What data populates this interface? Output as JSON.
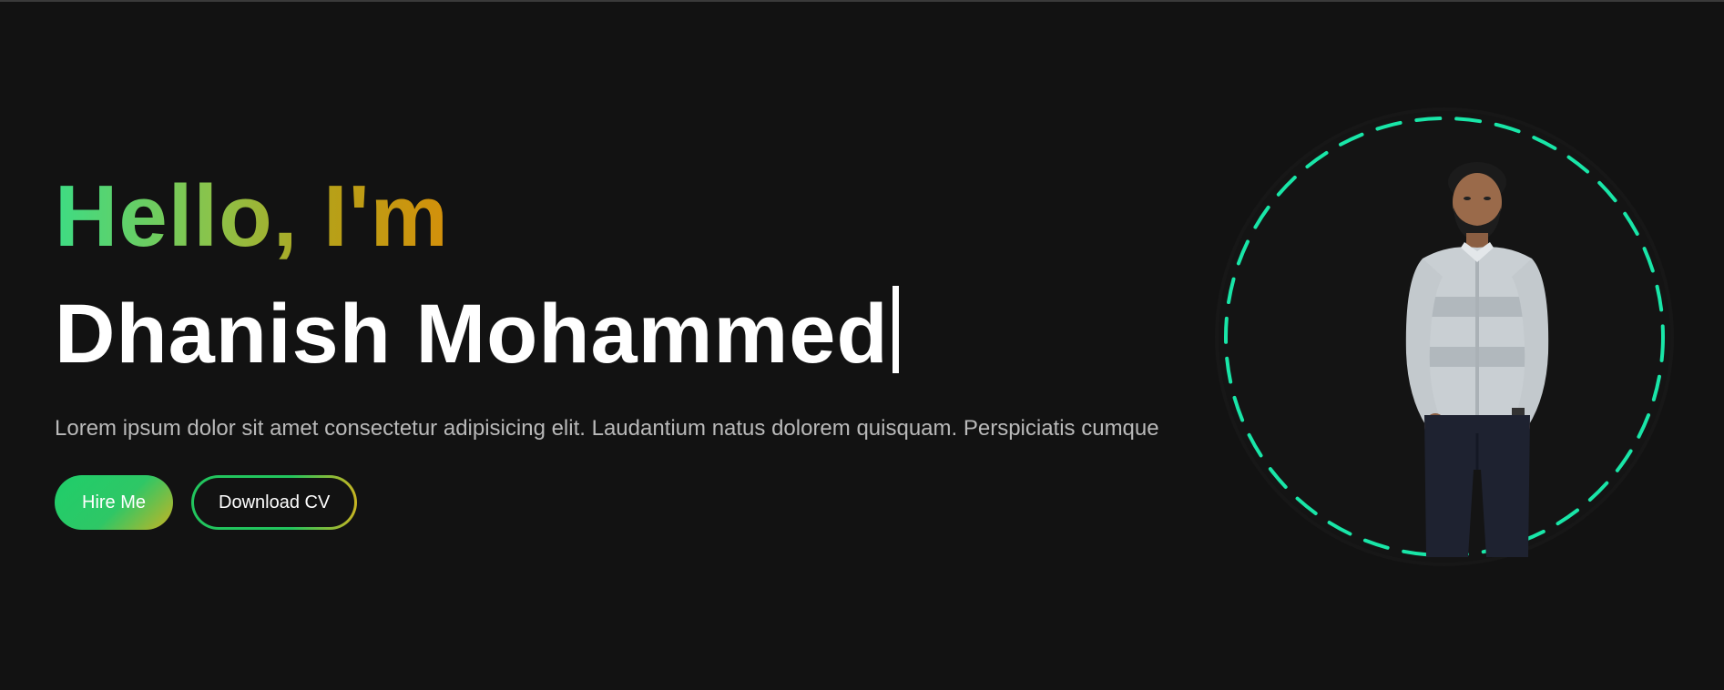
{
  "hero": {
    "greeting": "Hello, I'm",
    "name": "Dhanish Mohammed",
    "description": "Lorem ipsum dolor sit amet consectetur adipisicing elit. Laudantium natus dolorem quisquam. Perspiciatis cumque",
    "buttons": {
      "hire_label": "Hire Me",
      "download_label": "Download CV"
    }
  },
  "colors": {
    "background": "#121212",
    "ring": "#19e6a8",
    "accent_green": "#22c55e",
    "accent_gold": "#d4900a"
  },
  "icons": {
    "typing_cursor": "text-cursor-icon"
  }
}
